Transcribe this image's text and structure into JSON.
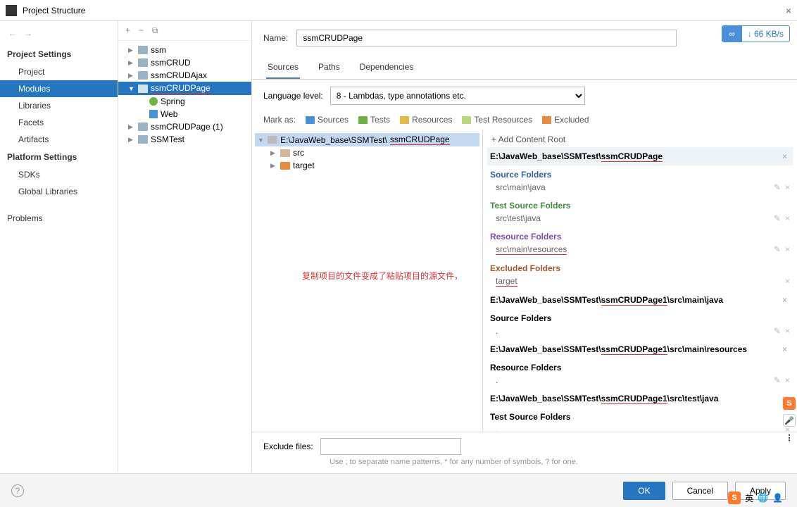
{
  "title": "Project Structure",
  "speed": "66 KB/s",
  "nav": {
    "back": "←",
    "fwd": "→",
    "section1": "Project Settings",
    "items1": [
      "Project",
      "Modules",
      "Libraries",
      "Facets",
      "Artifacts"
    ],
    "section2": "Platform Settings",
    "items2": [
      "SDKs",
      "Global Libraries"
    ],
    "problems": "Problems"
  },
  "tree": {
    "tools": [
      "+",
      "−",
      "⧉"
    ],
    "nodes": [
      {
        "label": "ssm",
        "indent": 1
      },
      {
        "label": "ssmCRUD",
        "indent": 1
      },
      {
        "label": "ssmCRUDAjax",
        "indent": 1
      },
      {
        "label": "ssmCRUDPage",
        "indent": 1,
        "sel": true,
        "open": true,
        "red": true
      },
      {
        "label": "Spring",
        "indent": 2,
        "ico": "spring"
      },
      {
        "label": "Web",
        "indent": 2,
        "ico": "web"
      },
      {
        "label": "ssmCRUDPage (1)",
        "indent": 1
      },
      {
        "label": "SSMTest",
        "indent": 1
      }
    ]
  },
  "name_label": "Name:",
  "name_value": "ssmCRUDPage",
  "tabs": [
    "Sources",
    "Paths",
    "Dependencies"
  ],
  "lang_label": "Language level:",
  "lang_value": "8 - Lambdas, type annotations etc.",
  "markas_label": "Mark as:",
  "markas": [
    "Sources",
    "Tests",
    "Resources",
    "Test Resources",
    "Excluded"
  ],
  "filetree": {
    "root_prefix": "E:\\JavaWeb_base\\SSMTest\\",
    "root_link": "ssmCRUDPage",
    "children": [
      {
        "label": "src",
        "ico": "dir"
      },
      {
        "label": "target",
        "ico": "exc"
      }
    ],
    "note": "复制项目的文件变成了粘贴项目的源文件，"
  },
  "roots": {
    "add": "+ Add Content Root",
    "groups": [
      {
        "path_pre": "E:\\JavaWeb_base\\SSMTest\\",
        "path_red": "ssmCRUDPage",
        "path_post": "",
        "shade": true,
        "sections": [
          {
            "h": "Source Folders",
            "cls": "blue",
            "v": "src\\main\\java",
            "edit": true
          },
          {
            "h": "Test Source Folders",
            "cls": "green",
            "v": "src\\test\\java",
            "edit": true
          },
          {
            "h": "Resource Folders",
            "cls": "purple",
            "v": "src\\main\\resources",
            "edit": true,
            "vred": true
          },
          {
            "h": "Excluded Folders",
            "cls": "brown",
            "v": "target",
            "vred": true
          }
        ]
      },
      {
        "path_pre": "E:\\JavaWeb_base\\SSMTest\\",
        "path_red": "ssmCRUDPage1",
        "path_post": "\\src\\main\\java",
        "sections": [
          {
            "h": "Source Folders",
            "cls": "",
            "v": ".",
            "edit": true
          }
        ]
      },
      {
        "path_pre": "E:\\JavaWeb_base\\SSMTest\\",
        "path_red": "ssmCRUDPage1",
        "path_post": "\\src\\main\\resources",
        "sections": [
          {
            "h": "Resource Folders",
            "cls": "",
            "v": ".",
            "edit": true
          }
        ]
      },
      {
        "path_pre": "E:\\JavaWeb_base\\SSMTest\\",
        "path_red": "ssmCRUDPage1",
        "path_post": "\\src\\test\\java",
        "sections": [
          {
            "h": "Test Source Folders",
            "cls": "",
            "v": "."
          }
        ]
      }
    ]
  },
  "exclude_label": "Exclude files:",
  "exclude_hint": "Use ; to separate name patterns, * for any number of symbols, ? for one.",
  "buttons": {
    "ok": "OK",
    "cancel": "Cancel",
    "apply": "Apply"
  },
  "tray_s": "S"
}
